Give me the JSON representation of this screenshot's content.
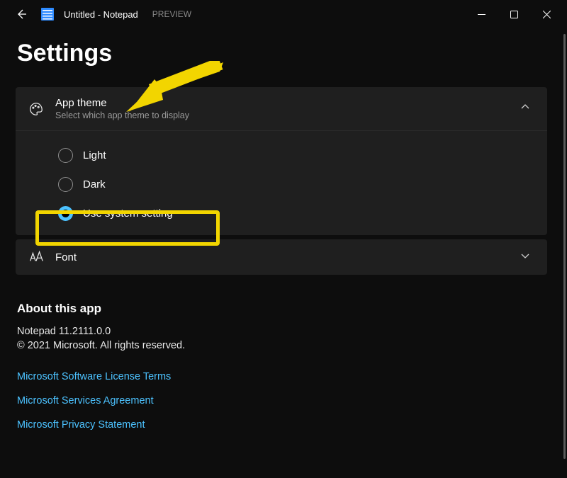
{
  "titlebar": {
    "title": "Untitled - Notepad",
    "preview": "PREVIEW"
  },
  "page": {
    "heading": "Settings"
  },
  "theme": {
    "title": "App theme",
    "subtitle": "Select which app theme to display",
    "options": {
      "light": "Light",
      "dark": "Dark",
      "system": "Use system setting"
    }
  },
  "font": {
    "title": "Font"
  },
  "about": {
    "heading": "About this app",
    "version": "Notepad 11.2111.0.0",
    "copyright": "© 2021 Microsoft. All rights reserved."
  },
  "links": {
    "license": "Microsoft Software License Terms",
    "services": "Microsoft Services Agreement",
    "privacy": "Microsoft Privacy Statement"
  }
}
